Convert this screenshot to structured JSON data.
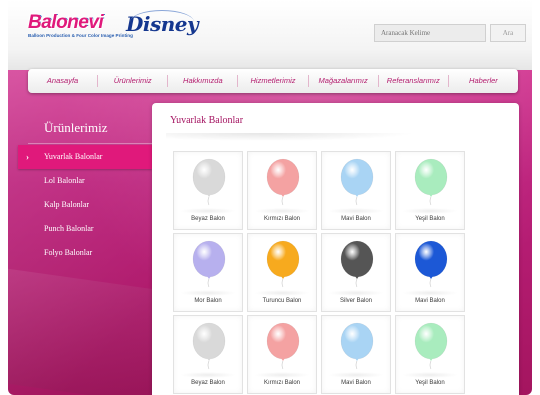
{
  "header": {
    "logo": {
      "brand": "Balonevi",
      "tagline": "Balloon Production & Four Color Image Printing"
    },
    "partner": "Disney",
    "search": {
      "placeholder": "Aranacak Kelime",
      "button_label": "Ara"
    }
  },
  "nav": {
    "items": [
      {
        "label": "Anasayfa"
      },
      {
        "label": "Ürünlerimiz"
      },
      {
        "label": "Hakkımızda"
      },
      {
        "label": "Hizmetlerimiz"
      },
      {
        "label": "Mağazalarımız"
      },
      {
        "label": "Referanslarımız"
      },
      {
        "label": "Haberler"
      }
    ]
  },
  "sidebar": {
    "title": "Ürünlerimiz",
    "active_icon": "chevron-right-icon",
    "items": [
      {
        "label": "Yuvarlak Balonlar",
        "active": true
      },
      {
        "label": "Lol Balonlar"
      },
      {
        "label": "Kalp Balonlar"
      },
      {
        "label": "Punch Balonlar"
      },
      {
        "label": "Folyo Balonlar"
      }
    ]
  },
  "content": {
    "title": "Yuvarlak Balonlar",
    "products": [
      {
        "label": "Beyaz Balon",
        "color": "#d9d9d9",
        "icon": "balloon-icon"
      },
      {
        "label": "Kırmızı Balon",
        "color": "#f4a2a2",
        "icon": "balloon-icon"
      },
      {
        "label": "Mavi Balon",
        "color": "#a9d4f4",
        "icon": "balloon-icon"
      },
      {
        "label": "Yeşil Balon",
        "color": "#a9ecbe",
        "icon": "balloon-icon"
      },
      {
        "label": "Mor Balon",
        "color": "#b7b0ee",
        "icon": "balloon-icon"
      },
      {
        "label": "Turuncu Balon",
        "color": "#f7aa1e",
        "icon": "balloon-icon"
      },
      {
        "label": "Silver Balon",
        "color": "#555555",
        "icon": "balloon-icon"
      },
      {
        "label": "Mavi Balon",
        "color": "#1c58d6",
        "icon": "balloon-icon"
      },
      {
        "label": "Beyaz Balon",
        "color": "#d9d9d9",
        "icon": "balloon-icon"
      },
      {
        "label": "Kırmızı Balon",
        "color": "#f4a2a2",
        "icon": "balloon-icon"
      },
      {
        "label": "Mavi Balon",
        "color": "#a9d4f4",
        "icon": "balloon-icon"
      },
      {
        "label": "Yeşil Balon",
        "color": "#a9ecbe",
        "icon": "balloon-icon"
      }
    ]
  },
  "colors": {
    "accent": "#e0197b",
    "stage": "#bb1f7a",
    "nav_text": "#b31c6e"
  }
}
